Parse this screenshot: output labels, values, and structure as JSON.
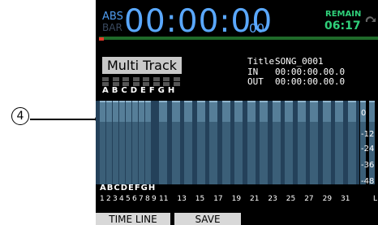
{
  "callout": {
    "number": "4"
  },
  "counter": {
    "mode_abs": "ABS",
    "mode_bar": "BAR",
    "time": "00:00:00",
    "frames": "00",
    "remain_label": "REMAIN",
    "remain_value": "06:17"
  },
  "mode_button": "Multi Track",
  "song_info": {
    "title_label": "Title",
    "title_value": "SONG_0001",
    "in_label": "IN",
    "in_value": "00:00:00.00.0",
    "out_label": "OUT",
    "out_value": "00:00:00.00.0"
  },
  "group_letters_top": "ABCDEFGH",
  "group_letters_bottom": "ABCDEFGH",
  "channel_numbers": [
    "1",
    "2",
    "3",
    "4",
    "5",
    "6",
    "7",
    "8",
    "9",
    "11",
    "13",
    "15",
    "17",
    "19",
    "21",
    "23",
    "25",
    "27",
    "29",
    "31"
  ],
  "meter_scale": [
    "0",
    "-12",
    "-24",
    "-36",
    "-48"
  ],
  "stereo_label": "L",
  "tabs": [
    "TIME LINE",
    "SAVE"
  ],
  "colors": {
    "time_blue": "#5aa8ff",
    "remain_green": "#2fd07a",
    "meter_blue": "#3b5f78"
  }
}
